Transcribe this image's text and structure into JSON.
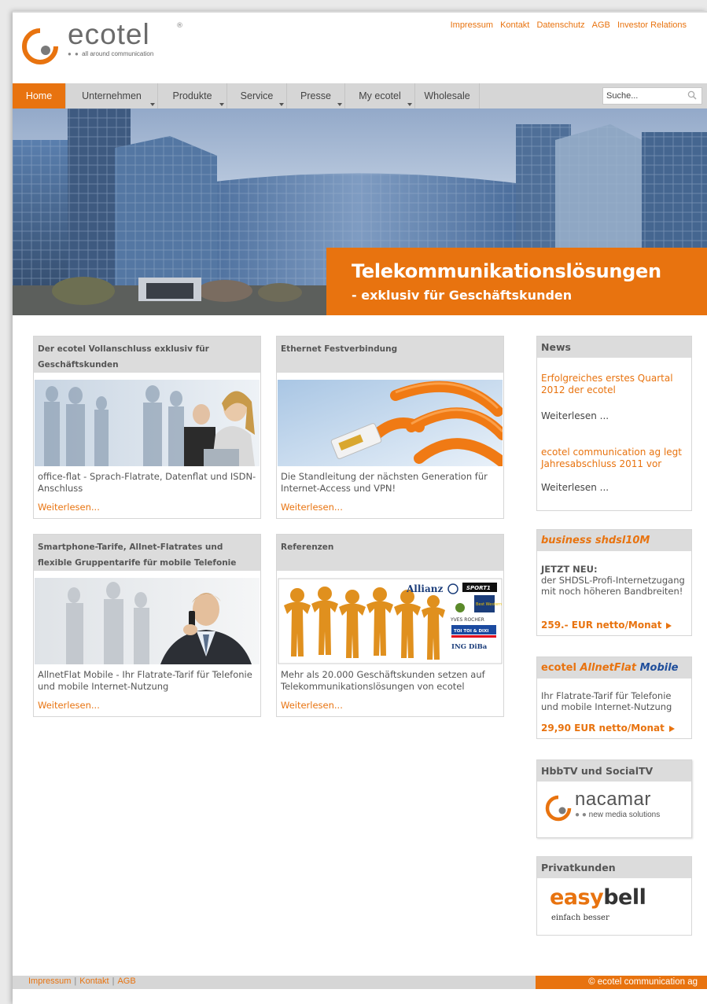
{
  "header": {
    "logo_word": "ecotel",
    "logo_reg": "®",
    "logo_tagline": "all around communication",
    "top_links": [
      "Impressum",
      "Kontakt",
      "Datenschutz",
      "AGB",
      "Investor Relations"
    ]
  },
  "nav": {
    "items": [
      {
        "label": "Home"
      },
      {
        "label": "Unternehmen"
      },
      {
        "label": "Produkte"
      },
      {
        "label": "Service"
      },
      {
        "label": "Presse"
      },
      {
        "label": "My ecotel"
      },
      {
        "label": "Wholesale"
      }
    ],
    "search_placeholder": "Suche..."
  },
  "hero": {
    "title": "Telekommunikationslösungen",
    "subtitle": "- exklusiv für Geschäftskunden"
  },
  "teasers": [
    {
      "title": "Der ecotel Vollanschluss exklusiv für Geschäftskunden",
      "text": "office-flat - Sprach-Flatrate, Datenflat und ISDN-Anschluss",
      "more": "Weiterlesen..."
    },
    {
      "title": "Ethernet Festverbindung",
      "text": "Die Standleitung der nächsten Generation für Internet-Access und VPN!",
      "more": "Weiterlesen..."
    },
    {
      "title": "Smartphone-Tarife, Allnet-Flatrates und flexible Gruppentarife für mobile Telefonie",
      "text": "AllnetFlat Mobile - Ihr Flatrate-Tarif für Telefonie und mobile Internet-Nutzung",
      "more": "Weiterlesen..."
    },
    {
      "title": "Referenzen",
      "text": "Mehr als 20.000 Geschäftskunden setzen auf Telekommunikationslösungen von ecotel",
      "more": "Weiterlesen...",
      "logos": [
        "Allianz",
        "SPORT1",
        "Best Western",
        "YVES ROCHER",
        "TOI TOI & DIXI",
        "ING DiBa"
      ]
    }
  ],
  "sidebar": {
    "news": {
      "heading": "News",
      "items": [
        {
          "title": "Erfolgreiches erstes Quartal 2012 der ecotel",
          "more": "Weiterlesen ..."
        },
        {
          "title": "ecotel communication ag legt Jahresabschluss 2011 vor",
          "more": "Weiterlesen ..."
        }
      ]
    },
    "shdsl": {
      "heading": "business shdsl10M",
      "lead": "JETZT NEU:",
      "text": "der SHDSL-Profi-Internetzugang mit noch höheren Bandbreiten!",
      "price": "259.- EUR netto/Monat"
    },
    "allnet": {
      "heading_a": "ecotel ",
      "heading_b": "AllnetFlat",
      "heading_c": " Mobile",
      "text": "Ihr Flatrate-Tarif für Telefonie und mobile Internet-Nutzung",
      "price": "29,90 EUR netto/Monat"
    },
    "hbbtv": {
      "heading": "HbbTV und SocialTV",
      "logo_word": "nacamar",
      "logo_tag": "new media solutions"
    },
    "privat": {
      "heading": "Privatkunden",
      "logo_a": "easy",
      "logo_b": "bell",
      "logo_tag": "einfach besser"
    }
  },
  "footer": {
    "links": [
      "Impressum",
      "Kontakt",
      "AGB"
    ],
    "copyright": "© ecotel communication ag"
  },
  "colors": {
    "accent": "#e8730f",
    "nav_bg": "#d6d6d6",
    "box_head": "#dcdcdc",
    "text": "#444444"
  }
}
